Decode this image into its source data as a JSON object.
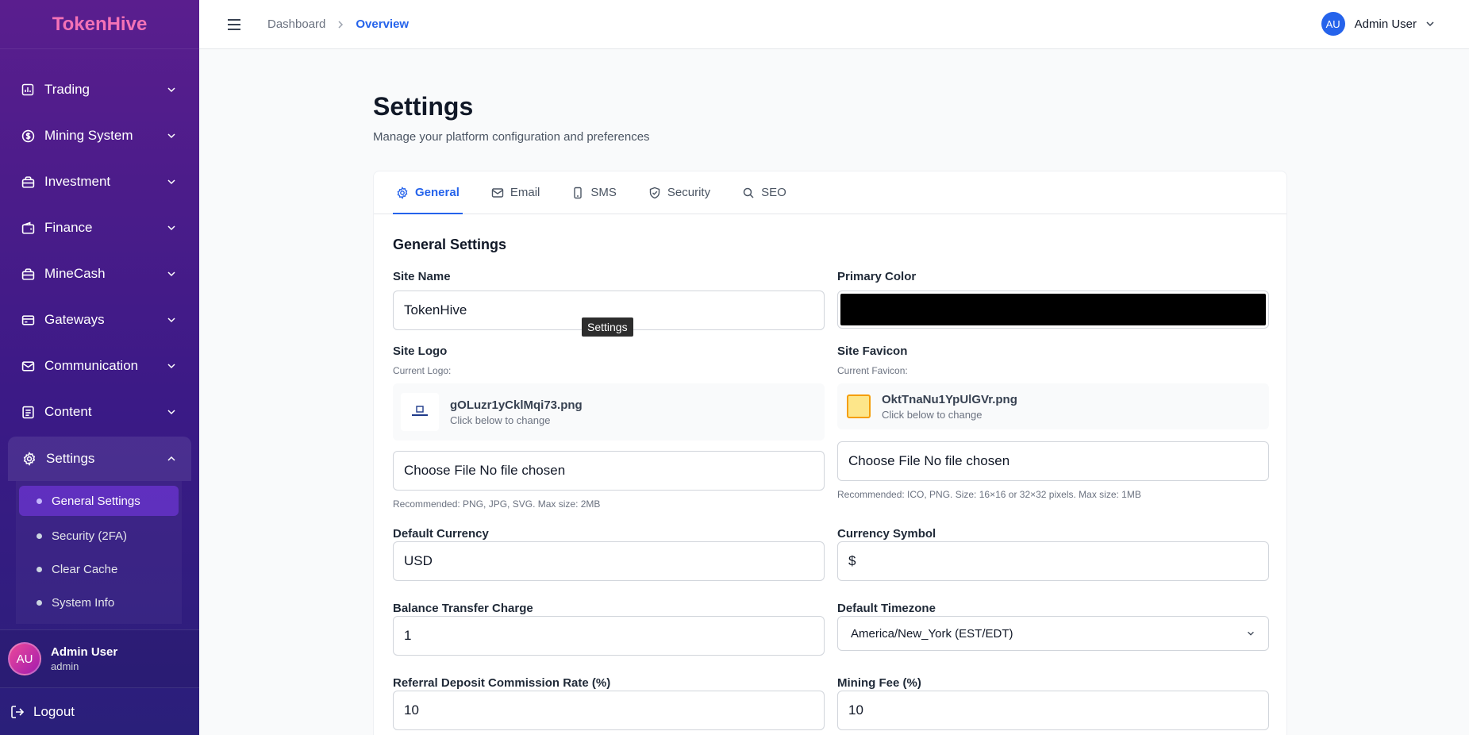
{
  "brand": {
    "name": "TokenHive",
    "color": "#f472b6"
  },
  "sidebar": {
    "items": [
      {
        "label": "Trading",
        "icon": "chart-icon"
      },
      {
        "label": "Mining System",
        "icon": "dollar-circle-icon"
      },
      {
        "label": "Investment",
        "icon": "briefcase-icon"
      },
      {
        "label": "Finance",
        "icon": "wallet-icon"
      },
      {
        "label": "MineCash",
        "icon": "briefcase-icon"
      },
      {
        "label": "Gateways",
        "icon": "credit-card-icon"
      },
      {
        "label": "Communication",
        "icon": "mail-icon"
      },
      {
        "label": "Content",
        "icon": "document-icon"
      },
      {
        "label": "Settings",
        "icon": "gear-icon",
        "expanded": true
      }
    ],
    "submenu": [
      {
        "label": "General Settings",
        "active": true
      },
      {
        "label": "Security (2FA)"
      },
      {
        "label": "Clear Cache"
      },
      {
        "label": "System Info"
      }
    ],
    "user": {
      "initials": "AU",
      "name": "Admin User",
      "role": "admin"
    },
    "logout_label": "Logout"
  },
  "topbar": {
    "breadcrumb": [
      "Dashboard",
      "Overview"
    ],
    "user": {
      "initials": "AU",
      "name": "Admin User"
    }
  },
  "page": {
    "title": "Settings",
    "subtitle": "Manage your platform configuration and preferences"
  },
  "tabs": [
    {
      "label": "General",
      "icon": "gear-icon",
      "active": true
    },
    {
      "label": "Email",
      "icon": "mail-icon"
    },
    {
      "label": "SMS",
      "icon": "phone-icon"
    },
    {
      "label": "Security",
      "icon": "shield-icon"
    },
    {
      "label": "SEO",
      "icon": "search-icon"
    }
  ],
  "general": {
    "section_title": "General Settings",
    "tooltip": "Settings",
    "site_name": {
      "label": "Site Name",
      "value": "TokenHive"
    },
    "primary_color": {
      "label": "Primary Color",
      "value": "#000000"
    },
    "site_logo": {
      "label": "Site Logo",
      "current_label": "Current Logo:",
      "file_name": "gOLuzr1yCklMqi73.png",
      "hint": "Click below to change",
      "file_input": "Choose File No file chosen",
      "note": "Recommended: PNG, JPG, SVG. Max size: 2MB"
    },
    "site_favicon": {
      "label": "Site Favicon",
      "current_label": "Current Favicon:",
      "file_name": "OktTnaNu1YpUlGVr.png",
      "hint": "Click below to change",
      "file_input": "Choose File No file chosen",
      "note": "Recommended: ICO, PNG. Size: 16×16 or 32×32 pixels. Max size: 1MB"
    },
    "default_currency": {
      "label": "Default Currency",
      "value": "USD"
    },
    "currency_symbol": {
      "label": "Currency Symbol",
      "value": "$"
    },
    "balance_transfer_charge": {
      "label": "Balance Transfer Charge",
      "value": "1"
    },
    "default_timezone": {
      "label": "Default Timezone",
      "value": "America/New_York (EST/EDT)"
    },
    "referral_rate": {
      "label": "Referral Deposit Commission Rate (%)",
      "value": "10"
    },
    "mining_fee": {
      "label": "Mining Fee (%)",
      "value": "10"
    }
  }
}
